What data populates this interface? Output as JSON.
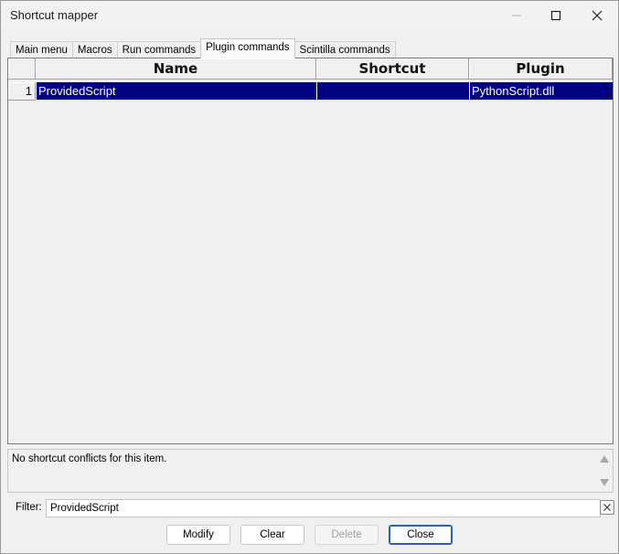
{
  "window": {
    "title": "Shortcut mapper"
  },
  "tabs": [
    {
      "label": "Main menu",
      "active": false
    },
    {
      "label": "Macros",
      "active": false
    },
    {
      "label": "Run commands",
      "active": false
    },
    {
      "label": "Plugin commands",
      "active": true
    },
    {
      "label": "Scintilla commands",
      "active": false
    }
  ],
  "grid": {
    "columns": [
      "Name",
      "Shortcut",
      "Plugin"
    ],
    "rows": [
      {
        "num": "1",
        "name": "ProvidedScript",
        "shortcut": "",
        "plugin": "PythonScript.dll",
        "selected": true
      }
    ],
    "selection_color": "#000080"
  },
  "info": {
    "text": "No shortcut conflicts for this item."
  },
  "filter": {
    "label": "Filter:",
    "value": "ProvidedScript"
  },
  "buttons": {
    "modify": "Modify",
    "clear": "Clear",
    "delete": "Delete",
    "close": "Close"
  }
}
